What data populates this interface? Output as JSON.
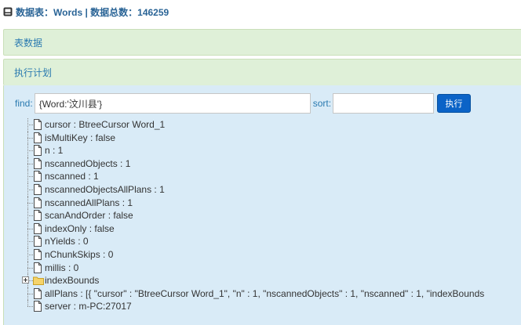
{
  "header": {
    "title": "数据表：Words | 数据总数：146259",
    "icon": "database-icon"
  },
  "panels": [
    {
      "label": "表数据"
    },
    {
      "label": "执行计划"
    }
  ],
  "query": {
    "find_label": "find:",
    "find_value": "{Word:'汶川县'}",
    "sort_label": "sort:",
    "sort_value": "",
    "execute_label": "执行"
  },
  "tree": [
    {
      "text": "cursor : BtreeCursor Word_1",
      "icon": "file-icon"
    },
    {
      "text": "isMultiKey : false",
      "icon": "file-icon"
    },
    {
      "text": "n : 1",
      "icon": "file-icon"
    },
    {
      "text": "nscannedObjects : 1",
      "icon": "file-icon"
    },
    {
      "text": "nscanned : 1",
      "icon": "file-icon"
    },
    {
      "text": "nscannedObjectsAllPlans : 1",
      "icon": "file-icon"
    },
    {
      "text": "nscannedAllPlans : 1",
      "icon": "file-icon"
    },
    {
      "text": "scanAndOrder : false",
      "icon": "file-icon"
    },
    {
      "text": "indexOnly : false",
      "icon": "file-icon"
    },
    {
      "text": "nYields : 0",
      "icon": "file-icon"
    },
    {
      "text": "nChunkSkips : 0",
      "icon": "file-icon"
    },
    {
      "text": "millis : 0",
      "icon": "file-icon"
    },
    {
      "text": "indexBounds",
      "icon": "folder-icon",
      "expandable": true
    },
    {
      "text": "allPlans : [{ \"cursor\" : \"BtreeCursor Word_1\", \"n\" : 1, \"nscannedObjects\" : 1, \"nscanned\" : 1, \"indexBounds",
      "icon": "file-icon"
    },
    {
      "text": "server : m-PC:27017",
      "icon": "file-icon"
    }
  ],
  "colors": {
    "accent": "#2a7ab0",
    "panel_head_bg": "#dff0d8",
    "panel_body_bg": "#d9ebf7",
    "button_bg": "#0b63c7"
  }
}
